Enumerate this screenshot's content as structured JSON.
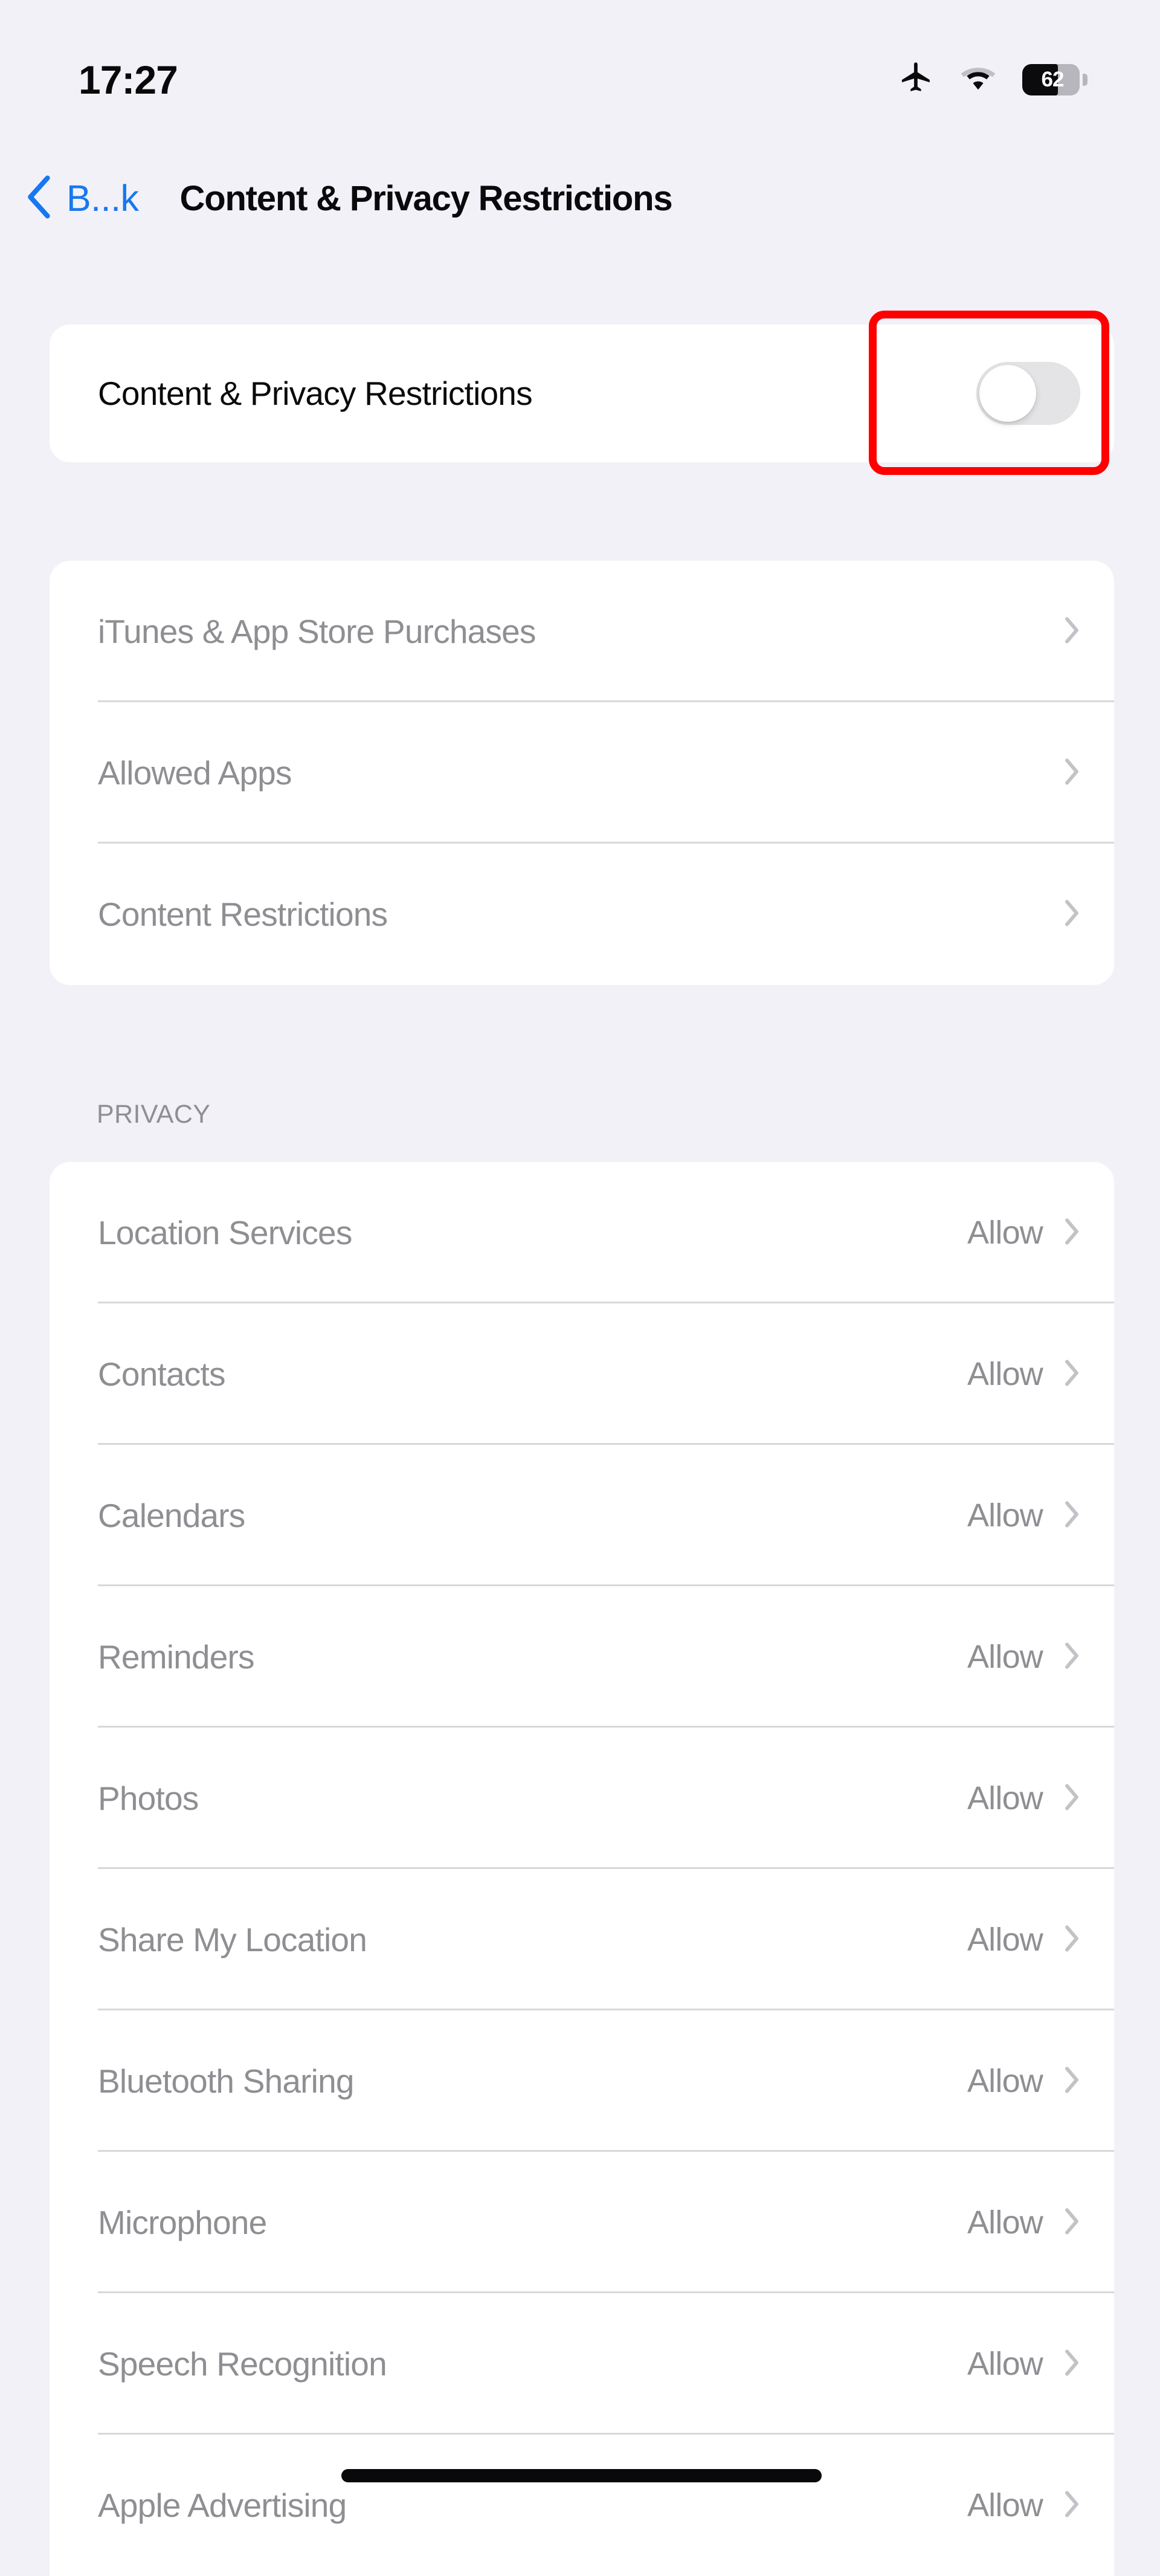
{
  "status_bar": {
    "time": "17:27",
    "airplane_icon": "airplane-mode-icon",
    "wifi_icon": "wifi-icon",
    "battery_percent": "62",
    "battery_level": 62
  },
  "nav": {
    "back_label": "B...k",
    "back_icon": "chevron-left-icon",
    "title": "Content & Privacy Restrictions"
  },
  "toggle_section": {
    "label": "Content & Privacy Restrictions",
    "toggle_state": "off",
    "highlight_color": "#FF0000"
  },
  "restrictions_group": {
    "items": [
      {
        "label": "iTunes & App Store Purchases",
        "chevron": "chevron-right-icon"
      },
      {
        "label": "Allowed Apps",
        "chevron": "chevron-right-icon"
      },
      {
        "label": "Content Restrictions",
        "chevron": "chevron-right-icon"
      }
    ]
  },
  "privacy_section": {
    "header": "PRIVACY",
    "items": [
      {
        "label": "Location Services",
        "value": "Allow",
        "chevron": "chevron-right-icon"
      },
      {
        "label": "Contacts",
        "value": "Allow",
        "chevron": "chevron-right-icon"
      },
      {
        "label": "Calendars",
        "value": "Allow",
        "chevron": "chevron-right-icon"
      },
      {
        "label": "Reminders",
        "value": "Allow",
        "chevron": "chevron-right-icon"
      },
      {
        "label": "Photos",
        "value": "Allow",
        "chevron": "chevron-right-icon"
      },
      {
        "label": "Share My Location",
        "value": "Allow",
        "chevron": "chevron-right-icon"
      },
      {
        "label": "Bluetooth Sharing",
        "value": "Allow",
        "chevron": "chevron-right-icon"
      },
      {
        "label": "Microphone",
        "value": "Allow",
        "chevron": "chevron-right-icon"
      },
      {
        "label": "Speech Recognition",
        "value": "Allow",
        "chevron": "chevron-right-icon"
      },
      {
        "label": "Apple Advertising",
        "value": "Allow",
        "chevron": "chevron-right-icon"
      }
    ]
  },
  "colors": {
    "background": "#F2F1F7",
    "card": "#FFFFFF",
    "accent_blue": "#1778EF",
    "disabled_text": "#8E8E93",
    "enabled_text": "#0A0A0C",
    "separator": "#D8D8DC",
    "toggle_off_track": "#E4E4E7",
    "highlight": "#FF0000"
  }
}
